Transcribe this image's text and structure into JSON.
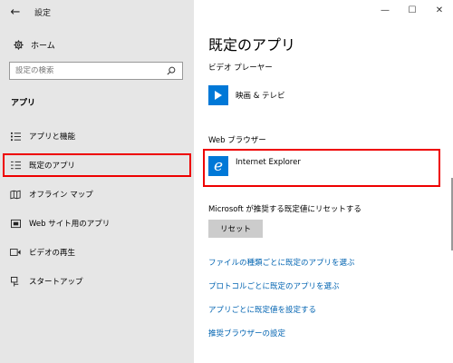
{
  "window": {
    "title": "設定",
    "back_icon": "arrow-left-icon",
    "controls": [
      "—",
      "☐",
      "✕"
    ]
  },
  "sidebar": {
    "home_label": "ホーム",
    "search_placeholder": "設定の検索",
    "section_label": "アプリ",
    "items": [
      {
        "label": "アプリと機能",
        "icon": "apps-list-icon"
      },
      {
        "label": "既定のアプリ",
        "icon": "default-apps-icon",
        "selected": true
      },
      {
        "label": "オフライン マップ",
        "icon": "offline-map-icon"
      },
      {
        "label": "Web サイト用のアプリ",
        "icon": "web-app-icon"
      },
      {
        "label": "ビデオの再生",
        "icon": "video-icon"
      },
      {
        "label": "スタートアップ",
        "icon": "startup-icon"
      }
    ]
  },
  "content": {
    "page_title": "既定のアプリ",
    "video_player_label": "ビデオ プレーヤー",
    "video_app": "映画 & テレビ",
    "web_browser_label": "Web ブラウザー",
    "browser_app": "Internet Explorer",
    "reset_description": "Microsoft が推奨する既定値にリセットする",
    "reset_button": "リセット",
    "links": [
      "ファイルの種類ごとに既定のアプリを選ぶ",
      "プロトコルごとに既定のアプリを選ぶ",
      "アプリごとに既定値を設定する",
      "推奨ブラウザーの設定"
    ]
  },
  "colors": {
    "accent": "#0078d7",
    "link": "#0063b1",
    "highlight": "#e00000",
    "sidebar_bg": "#e6e6e6"
  }
}
